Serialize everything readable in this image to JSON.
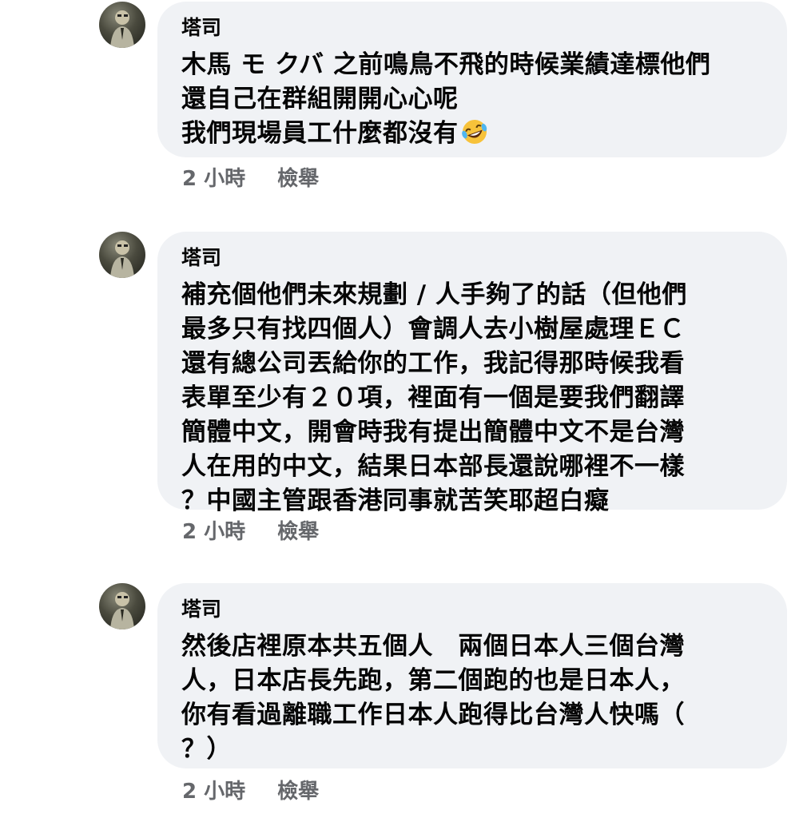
{
  "comments": [
    {
      "author": "塔司",
      "lines": [
        "木馬 モ クバ 之前鳴鳥不飛的時候業績達標他們",
        "還自己在群組開開心心呢",
        "我們現場員工什麼都沒有"
      ],
      "emoji": "rofl-emoji",
      "time": "2 小時",
      "report": "檢舉"
    },
    {
      "author": "塔司",
      "lines": [
        "補充個他們未來規劃 / 人手夠了的話（但他們",
        "最多只有找四個人）會調人去小樹屋處理ＥＣ",
        "還有總公司丟給你的工作，我記得那時候我看",
        "表單至少有２０項，裡面有一個是要我們翻譯",
        "簡體中文，開會時我有提出簡體中文不是台灣",
        "人在用的中文，結果日本部長還說哪裡不一樣",
        "？中國主管跟香港同事就苦笑耶超白癡"
      ],
      "time": "2 小時",
      "report": "檢舉"
    },
    {
      "author": "塔司",
      "lines": [
        "然後店裡原本共五個人　兩個日本人三個台灣",
        "人，日本店長先跑，第二個跑的也是日本人，",
        "你有看過離職工作日本人跑得比台灣人快嗎（",
        "？）"
      ],
      "time": "2 小時",
      "report": "檢舉"
    }
  ]
}
